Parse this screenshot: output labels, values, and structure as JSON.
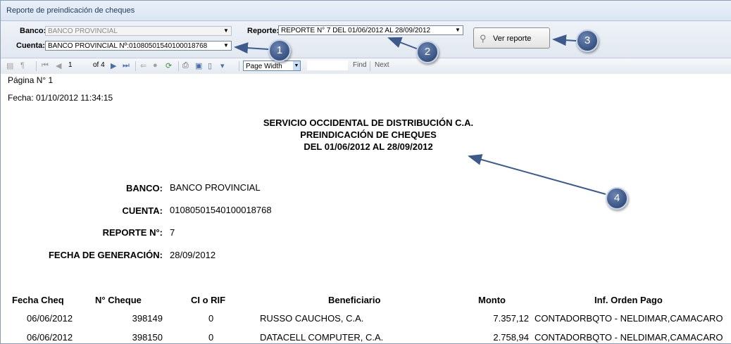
{
  "window": {
    "title": "Reporte de preindicación de cheques"
  },
  "params": {
    "banco_label": "Banco:",
    "banco_value": "BANCO PROVINCIAL",
    "cuenta_label": "Cuenta:",
    "cuenta_value": "BANCO PROVINCIAL Nº:01080501540100018768",
    "reporte_label": "Reporte:",
    "reporte_value": "REPORTE N° 7  DEL 01/06/2012 AL 28/09/2012",
    "ver_reporte_label": "Ver reporte"
  },
  "toolbar": {
    "page_input": "1",
    "page_total": "of 4",
    "zoom_value": "Page Width",
    "find_label": "Find",
    "next_label": "Next"
  },
  "report": {
    "page": "Página N° 1",
    "fecha": "Fecha: 01/10/2012 11:34:15",
    "title_line1": "SERVICIO OCCIDENTAL DE DISTRIBUCIÓN C.A.",
    "title_line2": "PREINDICACIÓN DE CHEQUES",
    "title_line3": "DEL 01/06/2012 AL 28/09/2012",
    "fields": [
      {
        "label": "BANCO:",
        "value": "BANCO PROVINCIAL"
      },
      {
        "label": "CUENTA:",
        "value": "01080501540100018768"
      },
      {
        "label": "REPORTE N°:",
        "value": "7"
      },
      {
        "label": "FECHA DE GENERACIÓN:",
        "value": "28/09/2012"
      }
    ],
    "columns": [
      "Fecha Cheq",
      "N° Cheque",
      "CI o RIF",
      "Beneficiario",
      "Monto",
      "Inf. Orden Pago"
    ],
    "rows": [
      [
        "06/06/2012",
        "398149",
        "0",
        "RUSSO CAUCHOS, C.A.",
        "7.357,12",
        "CONTADORBQTO - NELDIMAR,CAMACARO"
      ],
      [
        "06/06/2012",
        "398150",
        "0",
        "DATACELL COMPUTER, C.A.",
        "2.758,94",
        "CONTADORBQTO - NELDIMAR,CAMACARO"
      ]
    ]
  },
  "callouts": [
    "1",
    "2",
    "3",
    "4"
  ],
  "colors": {
    "callout": "#2b4a80",
    "arrow": "#3d5a8a"
  }
}
